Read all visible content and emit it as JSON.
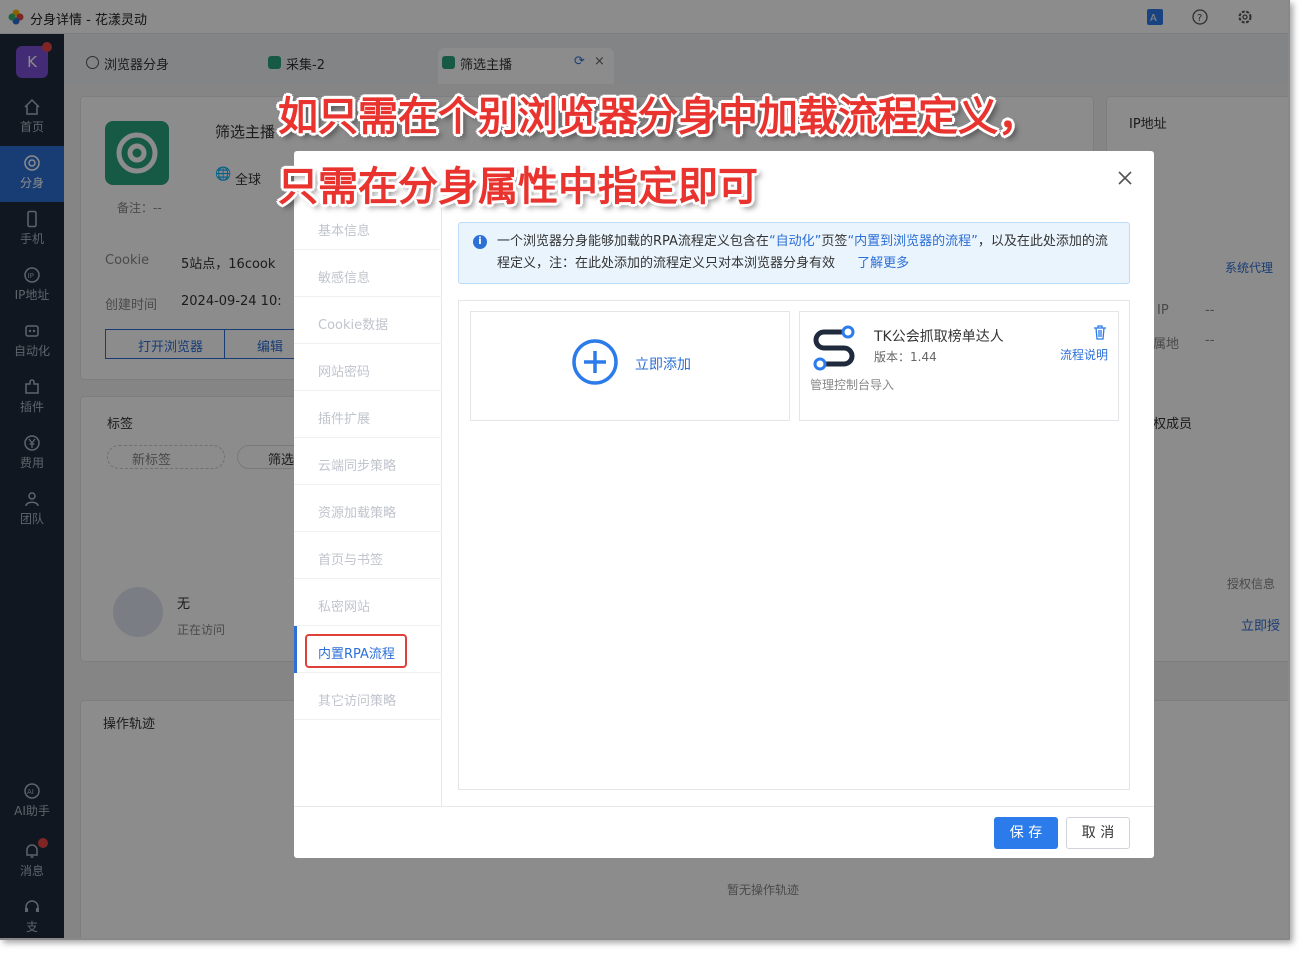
{
  "window": {
    "title": "分身详情 - 花漾灵动"
  },
  "sidebar": {
    "avatar": "K",
    "items": [
      {
        "label": "首页",
        "icon": "home-icon"
      },
      {
        "label": "分身",
        "icon": "browser-icon"
      },
      {
        "label": "手机",
        "icon": "phone-icon"
      },
      {
        "label": "IP地址",
        "icon": "ip-icon"
      },
      {
        "label": "自动化",
        "icon": "robot-icon"
      },
      {
        "label": "插件",
        "icon": "puzzle-icon"
      },
      {
        "label": "费用",
        "icon": "yen-icon"
      },
      {
        "label": "团队",
        "icon": "team-icon"
      },
      {
        "label": "AI助手",
        "icon": "ai-icon"
      },
      {
        "label": "消息",
        "icon": "bell-icon"
      },
      {
        "label": "支",
        "icon": "headset-icon"
      }
    ]
  },
  "tabs": [
    {
      "label": "浏览器分身"
    },
    {
      "label": "采集-2"
    },
    {
      "label": "筛选主播"
    }
  ],
  "background": {
    "profile_name": "筛选主播",
    "region": "全球",
    "remark": "备注：--",
    "cookie_label": "Cookie",
    "cookie_value": "5站点，16cook",
    "created_label": "创建时间",
    "created_value": "2024-09-24 10:",
    "open_browser": "打开浏览器",
    "edit": "编辑",
    "ip_title": "IP地址",
    "system_proxy": "系统代理",
    "ip_row1": "IP",
    "ip_row1_val": "--",
    "ip_row2": "属地",
    "ip_row2_val": "--",
    "tags_title": "标签",
    "new_tag": "新标签",
    "tag_chip": "筛选",
    "members_title": "权成员",
    "auth_info": "授权信息",
    "auth_link": "立即授",
    "visitor_name": "无",
    "visitor_status": "正在访问",
    "track_title": "操作轨迹",
    "no_track": "暂无操作轨迹"
  },
  "dialog": {
    "menu": [
      {
        "label": "基本信息"
      },
      {
        "label": "敏感信息"
      },
      {
        "label": "Cookie数据"
      },
      {
        "label": "网站密码"
      },
      {
        "label": "插件扩展"
      },
      {
        "label": "云端同步策略"
      },
      {
        "label": "资源加载策略"
      },
      {
        "label": "首页与书签"
      },
      {
        "label": "私密网站"
      },
      {
        "label": "内置RPA流程"
      },
      {
        "label": "其它访问策略"
      }
    ],
    "info_part1": "一个浏览器分身能够加载的RPA流程定义包含在",
    "info_link1": "“自动化”",
    "info_part2": "页签",
    "info_link2": "“内置到浏览器的流程”",
    "info_part3": "，以及在此处添加的流程定义，注：在此处添加的流程定义只对本浏览器分身有效",
    "info_more": "了解更多",
    "add_label": "立即添加",
    "flow": {
      "name": "TK公会抓取榜单达人",
      "version": "版本：1.44",
      "source": "管理控制台导入",
      "desc_link": "流程说明"
    },
    "save": "保 存",
    "cancel": "取 消"
  },
  "annotations": {
    "line1": "如只需在个别浏览器分身中加载流程定义，",
    "line2": "只需在分身属性中指定即可"
  },
  "colors": {
    "primary": "#2c6fd6",
    "sidebar_bg": "#1f2a3d",
    "highlight": "#e0403a",
    "caption": "#e8332e"
  }
}
